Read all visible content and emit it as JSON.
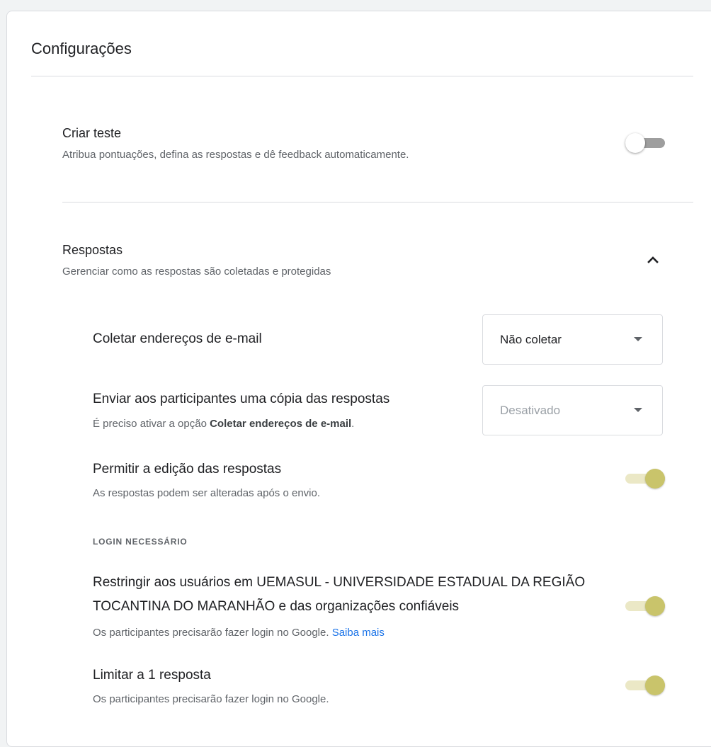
{
  "settings": {
    "title": "Configurações",
    "quiz": {
      "title": "Criar teste",
      "description": "Atribua pontuações, defina as respostas e dê feedback automaticamente.",
      "enabled": false
    },
    "responses": {
      "title": "Respostas",
      "description": "Gerenciar como as respostas são coletadas e protegidas",
      "expanded": true,
      "collect_emails": {
        "label": "Coletar endereços de e-mail",
        "value": "Não coletar"
      },
      "send_copy": {
        "label": "Enviar aos participantes uma cópia das respostas",
        "hint_prefix": "É preciso ativar a opção ",
        "hint_bold": "Coletar endereços de e-mail",
        "hint_suffix": ".",
        "value": "Desativado",
        "disabled": true
      },
      "allow_edit": {
        "label": "Permitir a edição das respostas",
        "description": "As respostas podem ser alteradas após o envio.",
        "enabled": true
      },
      "login_required_heading": "LOGIN NECESSÁRIO",
      "restrict_users": {
        "label": "Restringir aos usuários em UEMASUL - UNIVERSIDADE ESTADUAL DA REGIÃO TOCANTINA DO MARANHÃO e das organizações confiáveis",
        "description": "Os participantes precisarão fazer login no Google.",
        "link": "Saiba mais",
        "enabled": true
      },
      "limit_one": {
        "label": "Limitar a 1 resposta",
        "description": "Os participantes precisarão fazer login no Google.",
        "enabled": true
      }
    }
  },
  "colors": {
    "toggle_on_thumb": "#c9c46b",
    "toggle_on_track": "#ebe8c6",
    "toggle_off_track": "#9e9e9e",
    "link": "#1a73e8"
  },
  "icons": {
    "collapse": "chevron-up-icon",
    "dropdown": "caret-down-icon"
  }
}
